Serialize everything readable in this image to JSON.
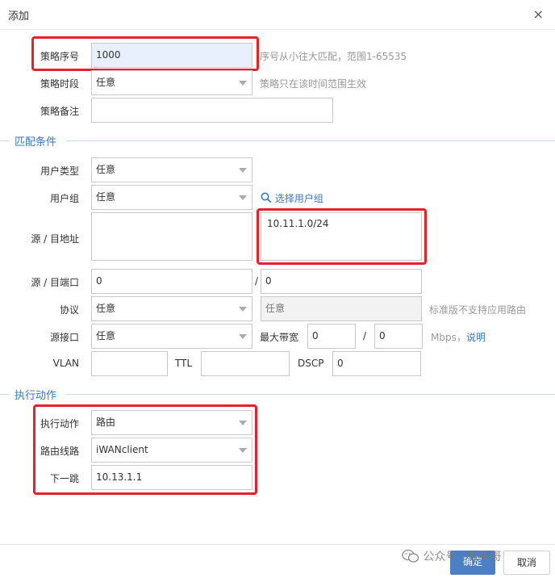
{
  "dialog": {
    "title": "添加",
    "close": "×"
  },
  "policy": {
    "seq_label": "策略序号",
    "seq_value": "1000",
    "seq_hint": "序号从小往大匹配，范围1-65535",
    "time_label": "策略时段",
    "time_value": "任意",
    "time_hint": "策略只在该时间范围生效",
    "note_label": "策略备注",
    "note_value": ""
  },
  "match": {
    "section_title": "匹配条件",
    "user_type_label": "用户类型",
    "user_type_value": "任意",
    "user_group_label": "用户组",
    "user_group_value": "任意",
    "select_group_link": "选择用户组",
    "addr_label": "源 / 目地址",
    "src_addr": "",
    "dst_addr": "10.11.1.0/24",
    "port_label": "源 / 目端口",
    "src_port": "0",
    "port_sep": "/",
    "dst_port": "0",
    "proto_label": "协议",
    "proto_value": "任意",
    "app_value": "任意",
    "proto_hint": "标准版不支持应用路由",
    "src_if_label": "源接口",
    "src_if_value": "任意",
    "bw_label": "最大带宽",
    "bw_up": "0",
    "bw_sep": "/",
    "bw_down": "0",
    "bw_unit": "Mbps，",
    "bw_help": "说明",
    "vlan_label": "VLAN",
    "vlan_value": "",
    "ttl_label": "TTL",
    "ttl_value": "",
    "dscp_label": "DSCP",
    "dscp_value": "0"
  },
  "action": {
    "section_title": "执行动作",
    "act_label": "执行动作",
    "act_value": "路由",
    "line_label": "路由线路",
    "line_value": "iWANclient",
    "next_hop_label": "下一跳",
    "next_hop_value": "10.13.1.1"
  },
  "footer": {
    "confirm": "确定",
    "cancel": "取消",
    "watermark": "公众号 · 铁军哥"
  },
  "colors": {
    "highlight": "#e8202a",
    "primary": "#4b7fc6",
    "section": "#3a77c4"
  },
  "icons": {
    "search": "search-icon",
    "wechat": "wechat-icon"
  }
}
